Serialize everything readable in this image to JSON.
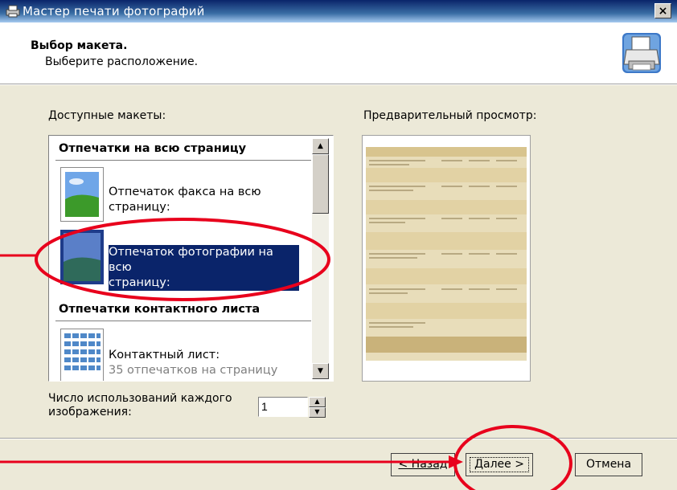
{
  "window": {
    "title": "Мастер печати фотографий",
    "close_label": "×"
  },
  "header": {
    "title": "Выбор макета.",
    "subtitle": "Выберите расположение."
  },
  "layouts": {
    "label": "Доступные макеты:",
    "groups": [
      {
        "title": "Отпечатки на всю страницу",
        "items": [
          {
            "line1": "Отпечаток факса на всю",
            "line2": "страницу:",
            "selected": false
          },
          {
            "line1": "Отпечаток фотографии на всю",
            "line2": "страницу:",
            "selected": true
          }
        ]
      },
      {
        "title": "Отпечатки контактного листа",
        "items": [
          {
            "line1": "Контактный лист:",
            "line2": "35 отпечатков на страницу",
            "selected": false
          }
        ]
      }
    ]
  },
  "usage": {
    "label_line1": "Число использований каждого",
    "label_line2": "изображения:",
    "value": "1"
  },
  "preview": {
    "label": "Предварительный просмотр:"
  },
  "buttons": {
    "back": "< Назад",
    "next": "Далее >",
    "cancel": "Отмена"
  },
  "colors": {
    "annotation": "#E8001C",
    "selection": "#0A246A",
    "dialog": "#ECE9D8"
  },
  "icons": {
    "title": "printer-icon",
    "header": "printer-icon",
    "thumb_photo": "landscape-photo-icon",
    "thumb_contact": "contact-sheet-icon"
  }
}
